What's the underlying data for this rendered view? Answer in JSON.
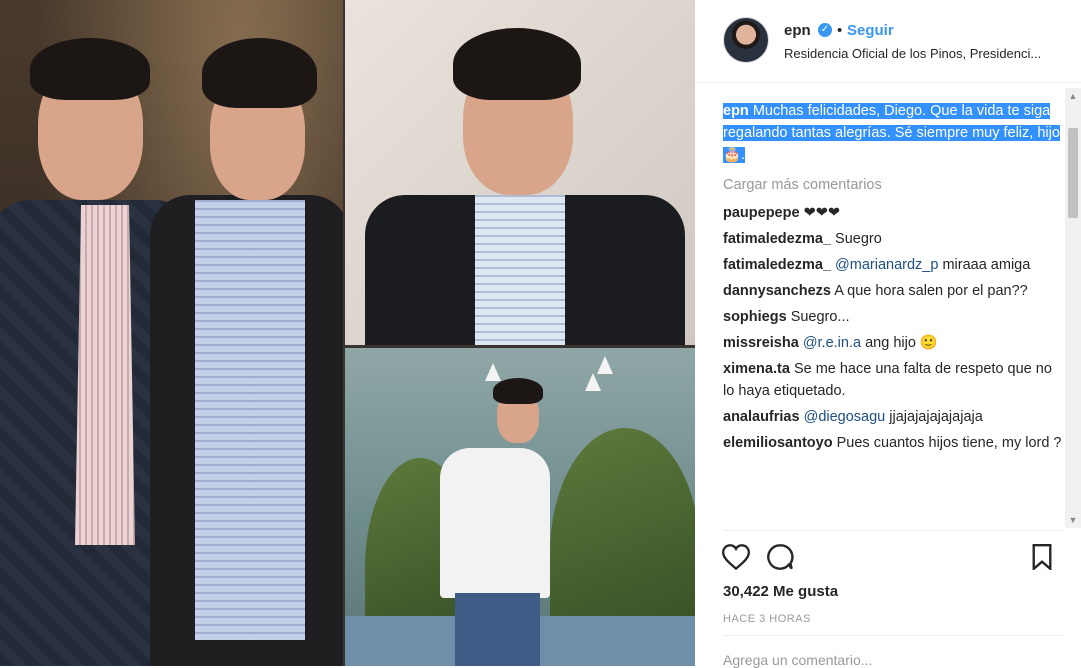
{
  "post": {
    "username": "epn",
    "follow_label": "Seguir",
    "separator": "•",
    "location": "Residencia Oficial de los Pinos, Presidenci...",
    "caption_user": "epn",
    "caption_text": "Muchas felicidades, Diego. Que la vida te siga regalando tantas alegrías. Sé siempre muy feliz, hijo🎂.",
    "load_more": "Cargar más comentarios",
    "likes": "30,422 Me gusta",
    "time": "HACE 3 HORAS",
    "add_comment_placeholder": "Agrega un comentario..."
  },
  "comments": [
    {
      "user": "paupepepe",
      "text": "❤❤❤",
      "mention": ""
    },
    {
      "user": "fatimaledezma_",
      "text": "Suegro",
      "mention": ""
    },
    {
      "user": "fatimaledezma_",
      "mention": "@marianardz_p",
      "text": "miraaa amiga"
    },
    {
      "user": "dannysanchezs",
      "text": "A que hora salen por el pan??",
      "mention": ""
    },
    {
      "user": "sophiegs",
      "text": "Suegro...",
      "mention": ""
    },
    {
      "user": "missreisha",
      "mention": "@r.e.in.a",
      "text": "ang hijo 🙂"
    },
    {
      "user": "ximena.ta",
      "text": "Se me hace una falta de respeto que no lo haya etiquetado.",
      "mention": ""
    },
    {
      "user": "analaufrias",
      "mention": "@diegosagu",
      "text": "jjajajajajajajaja"
    },
    {
      "user": "elemiliosantoyo",
      "text": "Pues cuantos hijos tiene, my lord ?",
      "mention": ""
    }
  ],
  "colors": {
    "link": "#3897f0",
    "selection": "#3390ff",
    "muted": "#999999"
  }
}
